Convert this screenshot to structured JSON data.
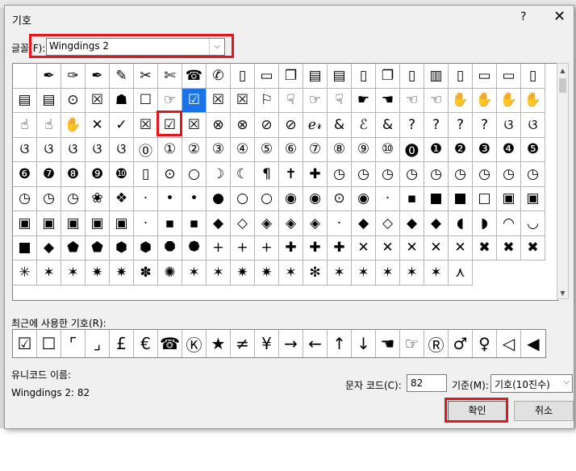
{
  "dialog": {
    "title": "기호",
    "help": "?",
    "close": "✕",
    "font_label": "글꼴(F):",
    "font_value": "Wingdings 2",
    "dropdown_arrow": "⌵",
    "recent_label": "최근에 사용한 기호(R):",
    "unicode_name_label": "유니코드 이름:",
    "unicode_name_value": "Wingdings 2: 82",
    "char_code_label": "문자 코드(C):",
    "char_code_value": "82",
    "base_label": "기준(M):",
    "base_value": "기호(10진수)",
    "ok": "확인",
    "cancel": "취소",
    "selected_index": 29,
    "accent_red": "#e8141c",
    "select_blue": "#1a73e8"
  },
  "symbols": [
    " ",
    "✒",
    "✑",
    "✒",
    "✎",
    "✂",
    "✄",
    "☎",
    "✆",
    "▯",
    "▭",
    "❐",
    "▤",
    "▤",
    "▯",
    "❐",
    "▯",
    "▥",
    "▯",
    "▭",
    "▭",
    "▯",
    "▤",
    "▤",
    "⊙",
    "☒",
    "☗",
    "☐",
    "☞",
    "☑",
    "☒",
    "☒",
    "⚐",
    "☟",
    "☞",
    "☟",
    "☛",
    "☚",
    "☜",
    "☜",
    "✋",
    "✋",
    "✋",
    "✋",
    "☝",
    "☝",
    "✋",
    "✕",
    "✓",
    "☒",
    "☑",
    "☒",
    "⊗",
    "⊗",
    "⊘",
    "⊘",
    "ℯ𝓇",
    "&",
    "ℰ",
    "&",
    "?",
    "?",
    "?",
    "?",
    "ଓ",
    "ଓ",
    "ଓ",
    "ଓ",
    "ଓ",
    "ଓ",
    "ଓ",
    "⓪",
    "①",
    "②",
    "③",
    "④",
    "⑤",
    "⑥",
    "⑦",
    "⑧",
    "⑨",
    "⑩",
    "⓿",
    "❶",
    "❷",
    "❸",
    "❹",
    "❺",
    "❻",
    "❼",
    "❽",
    "❾",
    "❿",
    "▯",
    "⊙",
    "○",
    "☽",
    "☾",
    "¶",
    "✝",
    "✚",
    "◷",
    "◷",
    "◷",
    "◷",
    "◷",
    "◷",
    "◷",
    "◷",
    "◷",
    "◷",
    "◷",
    "◷",
    "❀",
    "❖",
    "·",
    "•",
    "•",
    "●",
    "○",
    "○",
    "◉",
    "◉",
    "⊙",
    "◉",
    "·",
    "▪",
    "■",
    "■",
    "□",
    "▣",
    "▣",
    "▣",
    "▣",
    "▣",
    "▣",
    "▣",
    "·",
    "▪",
    "▪",
    "◆",
    "◇",
    "◈",
    "◈",
    "◈",
    "·",
    "◆",
    "◇",
    "◆",
    "◆",
    "◖",
    "◗",
    "◠",
    "◡",
    "■",
    "◆",
    "⬟",
    "⬟",
    "⬢",
    "⬢",
    "⯃",
    "⯄",
    "+",
    "+",
    "+",
    "✚",
    "✚",
    "✚",
    "✕",
    "✕",
    "✕",
    "✕",
    "✕",
    "✖",
    "✖",
    "✖",
    "✳",
    "✶",
    "✶",
    "✷",
    "✷",
    "✽",
    "✺",
    "✶",
    "✶",
    "✷",
    "✷",
    "✶",
    "✻",
    "✶",
    "✶",
    "✶",
    "✶",
    "✶",
    "⋏"
  ],
  "recent": [
    "☑",
    "☐",
    "⌜",
    "⌟",
    "£",
    "€",
    "☎",
    "Ⓚ",
    "★",
    "≠",
    "¥",
    "→",
    "←",
    "↑",
    "↓",
    "☚",
    "☞",
    "Ⓡ",
    "♂",
    "♀",
    "◁",
    "◀"
  ]
}
